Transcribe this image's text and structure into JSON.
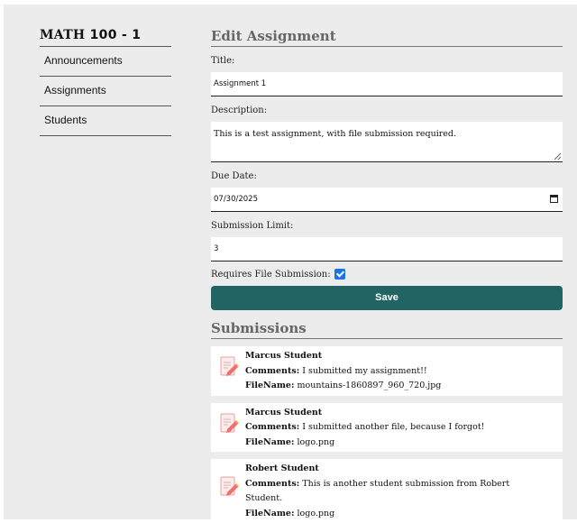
{
  "sidebar": {
    "course_title_word": "MATH",
    "course_title_rest": "100 - 1",
    "items": [
      {
        "label": "Announcements"
      },
      {
        "label": "Assignments"
      },
      {
        "label": "Students"
      }
    ]
  },
  "edit": {
    "heading": "Edit Assignment",
    "title_label": "Title:",
    "title_value": "Assignment 1",
    "description_label": "Description:",
    "description_value": "This is a test assignment, with file submission required.",
    "due_label": "Due Date:",
    "due_value": "07/30/2025",
    "limit_label": "Submission Limit:",
    "limit_value": "3",
    "requires_file_label": "Requires File Submission:",
    "requires_file_checked": true,
    "save_label": "Save"
  },
  "submissions": {
    "heading": "Submissions",
    "comments_key": "Comments:",
    "filename_key": "FileName:",
    "items": [
      {
        "student": "Marcus Student",
        "comments": "I submitted my assignment!!",
        "filename": "mountains-1860897_960_720.jpg"
      },
      {
        "student": "Marcus Student",
        "comments": "I submitted another file, because I forgot!",
        "filename": "logo.png"
      },
      {
        "student": "Robert Student",
        "comments": "This is another student submission from Robert",
        "comments_cont": "Student.",
        "filename": "logo.png"
      }
    ]
  },
  "colors": {
    "background": "#ececec",
    "save_button": "#216463",
    "checkbox": "#1a73e8"
  }
}
